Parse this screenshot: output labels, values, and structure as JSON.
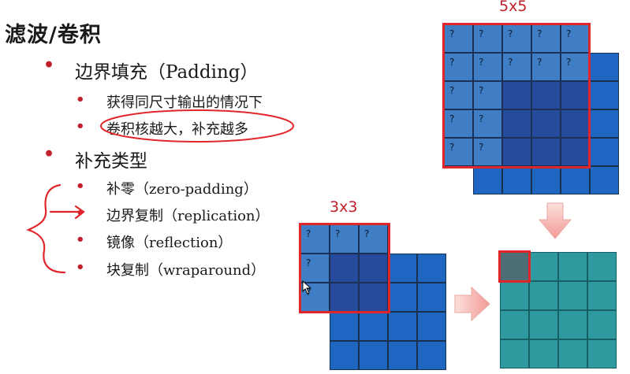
{
  "title": "滤波/卷积",
  "outline": [
    {
      "text": "边界填充（Padding）",
      "level": 1
    },
    {
      "text": "获得同尺寸输出的情况下",
      "level": 2
    },
    {
      "text": "卷积核越大，补充越多",
      "level": 2
    },
    {
      "text": "补充类型",
      "level": 1
    },
    {
      "text": "补零（zero-padding）",
      "level": 2
    },
    {
      "text": "边界复制（replication）",
      "level": 2
    },
    {
      "text": "镜像（reflection）",
      "level": 2
    },
    {
      "text": "块复制（wraparound）",
      "level": 2
    }
  ],
  "kernel_labels": {
    "large": "5x5",
    "small": "3x3"
  },
  "cell_mark": "?",
  "colors": {
    "accent": "#e0262a",
    "input_cell": "#1f66c3",
    "kernel_overlay": "rgba(60,90,165,0.6)",
    "output_cell": "#2e9aa0",
    "output_highlight": "#4e6e76",
    "arrow_fill": "#f6b8b4",
    "annotation_ink": "#e0262a"
  }
}
